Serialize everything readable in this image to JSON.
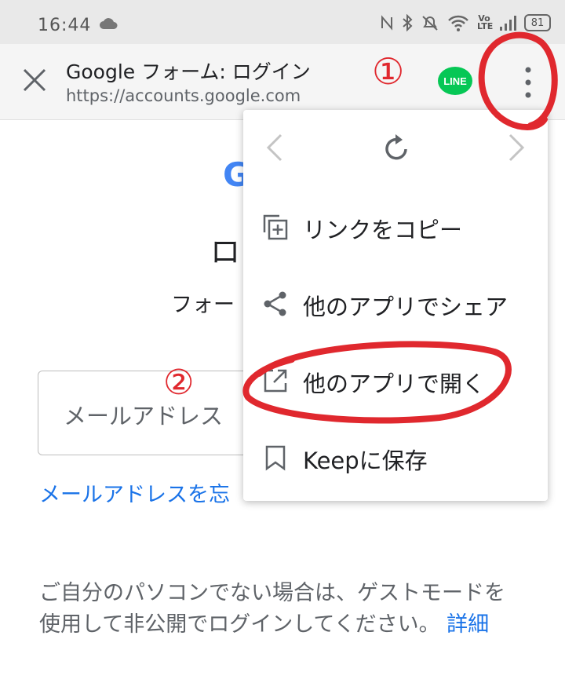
{
  "status_bar": {
    "time": "16:44",
    "battery": "81",
    "volte": "Vo LTE",
    "icons": [
      "cloud-icon",
      "nfc-icon",
      "bluetooth-icon",
      "mute-icon",
      "wifi-icon",
      "volte-icon",
      "signal-icon",
      "battery-icon"
    ]
  },
  "toolbar": {
    "title": "Google フォーム: ログイン",
    "url": "https://accounts.google.com",
    "line_label": "LINE",
    "line_color": "#06c755"
  },
  "annotations": {
    "marker_1": "①",
    "marker_2": "②",
    "color": "#e0282e"
  },
  "page": {
    "logo_partial": "G",
    "title_partial": "ロ",
    "subtitle_partial": "フォー",
    "email_placeholder_partial": "メールアドレス",
    "forgot_partial": "メールアドレスを忘",
    "notice_text": "ご自分のパソコンでない場合は、ゲストモードを使用して非公開でログインしてください。",
    "notice_link": "詳細"
  },
  "menu": {
    "items": [
      {
        "label": "リンクをコピー",
        "icon": "copy-link-icon"
      },
      {
        "label": "他のアプリでシェア",
        "icon": "share-icon"
      },
      {
        "label": "他のアプリで開く",
        "icon": "open-external-icon"
      },
      {
        "label": "Keepに保存",
        "icon": "bookmark-icon"
      }
    ]
  }
}
